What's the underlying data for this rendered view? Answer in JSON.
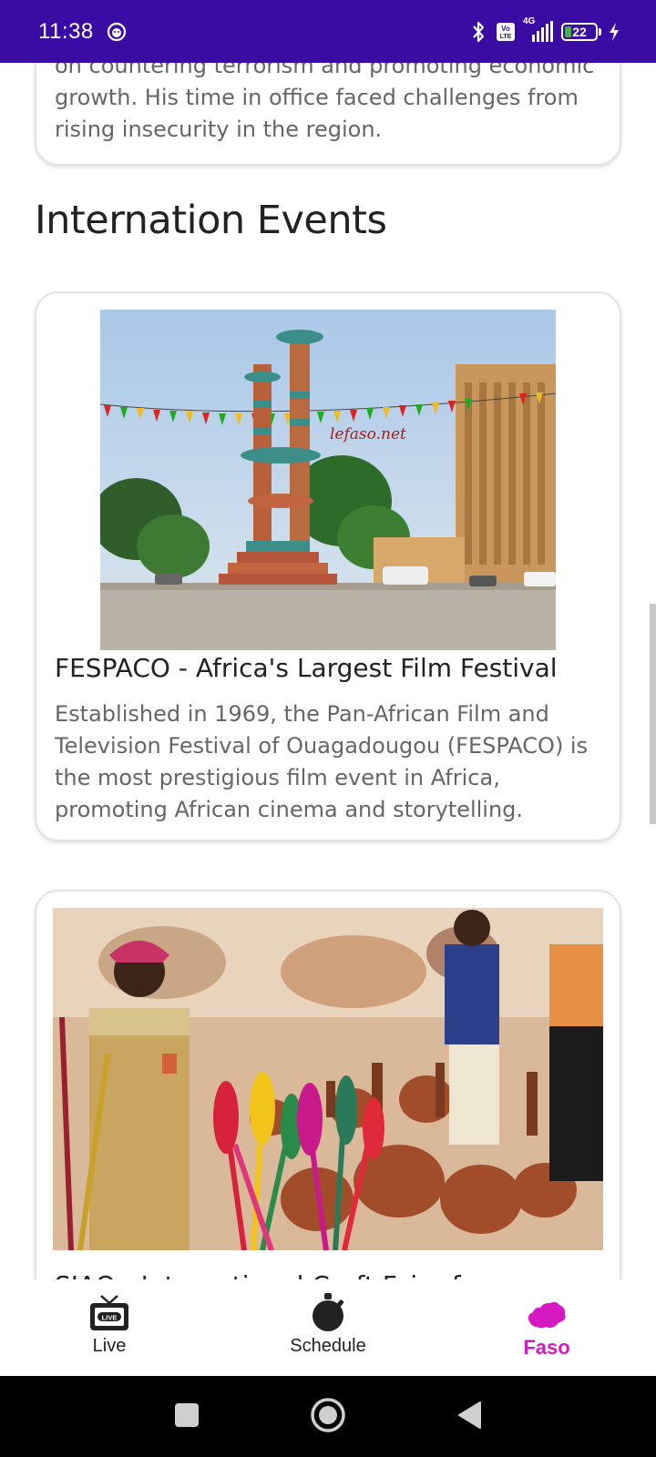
{
  "status_bar": {
    "time": "11:38",
    "network": "4G",
    "volte": "Vo LTE",
    "battery_level": "22",
    "battery_fraction": 0.22,
    "background_color": "#3a0ca3"
  },
  "previous_card": {
    "description": "on countering terrorism and promoting economic growth. His time in office faced challenges from rising insecurity in the region."
  },
  "section": {
    "title": "Internation Events"
  },
  "events": [
    {
      "image_icon": "fespaco-monument-photo",
      "image_watermark": "lefaso.net",
      "title": "FESPACO - Africa's Largest Film Festival",
      "description": "Established in 1969, the Pan-African Film and Television Festival of Ouagadougou (FESPACO) is the most prestigious film event in Africa, promoting African cinema and storytelling."
    },
    {
      "image_icon": "craft-market-photo",
      "title": "SIAO - International Craft Fair of"
    }
  ],
  "bottom_nav": {
    "items": [
      {
        "label": "Live",
        "icon": "tv-live-icon",
        "active": false
      },
      {
        "label": "Schedule",
        "icon": "stopwatch-icon",
        "active": false
      },
      {
        "label": "Faso",
        "icon": "burkina-map-icon",
        "active": true
      }
    ],
    "active_color": "#d419c1"
  },
  "system_nav": {
    "buttons": [
      "recent-apps",
      "home",
      "back"
    ]
  }
}
